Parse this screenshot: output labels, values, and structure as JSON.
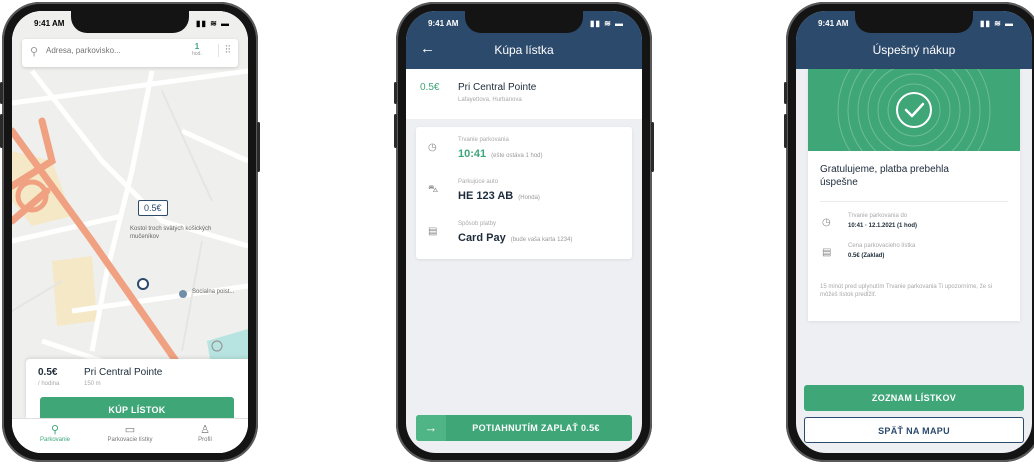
{
  "phone1": {
    "status_time": "9:41 AM",
    "status_icons": "▮▮ ≋ ▬",
    "search": {
      "placeholder": "Adresa, parkovisko...",
      "hours_value": "1",
      "hours_unit": "hod."
    },
    "map": {
      "pin_price": "0.5€",
      "poi_1": "Kostol troch svätých košických mučeníkov",
      "poi_2": "Socialna poist..."
    },
    "sheet": {
      "price": "0.5€",
      "price_sub": "/ hodina",
      "name": "Pri Central Pointe",
      "distance": "150 m"
    },
    "buy_button": "KÚP LÍSTOK",
    "nav": [
      {
        "label": "Parkovanie",
        "icon": "location-pin-icon"
      },
      {
        "label": "Parkovacie lístky",
        "icon": "ticket-icon"
      },
      {
        "label": "Profil",
        "icon": "profile-icon"
      }
    ]
  },
  "phone2": {
    "status_time": "9:41 AM",
    "status_icons": "▮▮ ≋ ▬",
    "title": "Kúpa lístka",
    "place": {
      "price": "0.5€",
      "name": "Pri Central Pointe",
      "address": "Lafayettova, Hurbanova"
    },
    "rows": [
      {
        "label": "Trvanie parkovania",
        "value": "10:41",
        "sub": "(ešte ostáva 1 hod)",
        "icon": "clock-icon"
      },
      {
        "label": "Parkujúce auto",
        "value": "HE 123 AB",
        "sub": "(Honda)",
        "icon": "car-icon"
      },
      {
        "label": "Spôsob platby",
        "value": "Card Pay",
        "sub": "(bude vaša karta 1234)",
        "icon": "card-icon"
      }
    ],
    "pay_button": "POTIAHNUTÍM ZAPLAŤ 0.5€"
  },
  "phone3": {
    "status_time": "9:41 AM",
    "status_icons": "▮▮ ≋ ▬",
    "title": "Úspešný nákup",
    "success_heading": "Gratulujeme, platba prebehla úspešne",
    "details": [
      {
        "label": "Trvanie parkovania do",
        "value": "10:41 · 12.1.2021 (1 hod)",
        "icon": "clock-icon"
      },
      {
        "label": "Cena parkovacieho lístka",
        "value": "0.5€ (Zaklad)",
        "icon": "receipt-icon"
      }
    ],
    "note": "15 minút pred uplynutím Trvanie parkovania Ti upozorníme, že si môžeš lístok predĺžiť.",
    "list_button": "ZOZNAM LÍSTKOV",
    "map_button": "SPÄŤ NA MAPU"
  }
}
